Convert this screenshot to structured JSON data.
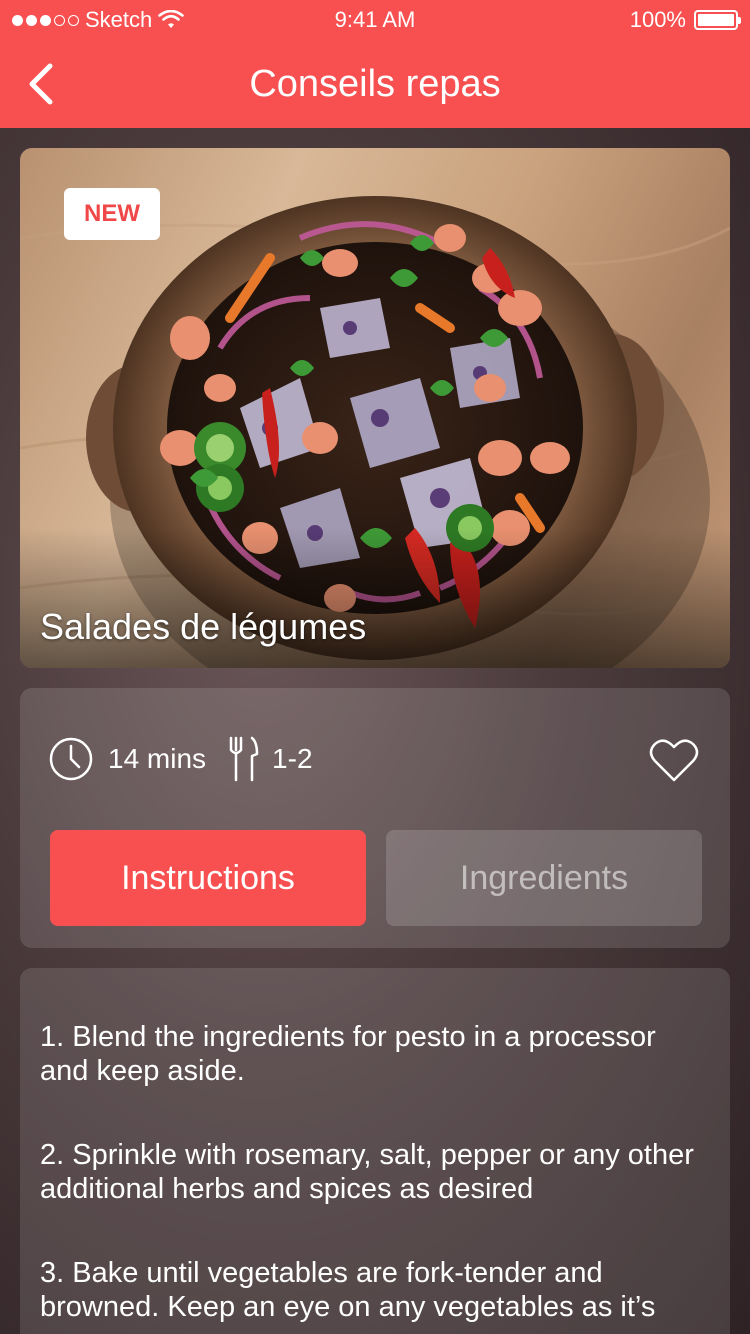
{
  "status_bar": {
    "carrier": "Sketch",
    "time": "9:41 AM",
    "battery": "100%",
    "battery_level": 1.0,
    "signal_bars": 3,
    "signal_total": 5
  },
  "nav": {
    "title": "Conseils repas",
    "back_icon": "chevron-left-icon"
  },
  "hero": {
    "badge": "NEW",
    "title": "Salades de légumes"
  },
  "meta": {
    "time_label": "14 mins",
    "servings_label": "1-2",
    "time_icon": "clock-icon",
    "servings_icon": "cutlery-icon",
    "favorite_icon": "heart-icon"
  },
  "tabs": {
    "active": "Instructions",
    "inactive": "Ingredients"
  },
  "steps": [
    "1. Blend the ingredients for pesto in a processor and keep aside.",
    "2. Sprinkle with rosemary, salt, pepper or any other additional herbs and spices as desired",
    "3. Bake until vegetables are fork-tender and browned. Keep an eye on any vegetables as it’s"
  ],
  "colors": {
    "accent": "#f85050",
    "badge_text": "#f04848"
  }
}
